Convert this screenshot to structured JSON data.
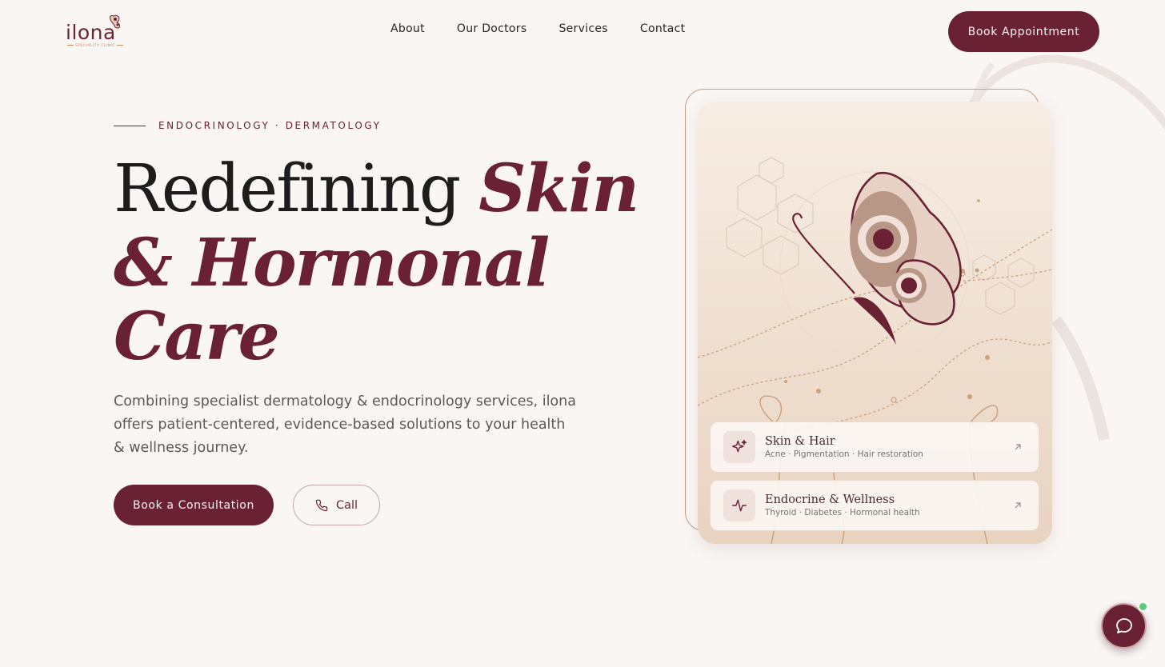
{
  "brand": {
    "name": "ilona",
    "tagline": "SPECIALITY CLINIC",
    "logo_icon": "butterfly-icon"
  },
  "nav": {
    "items": [
      "About",
      "Our Doctors",
      "Services",
      "Contact"
    ]
  },
  "header": {
    "cta_label": "Book Appointment"
  },
  "hero": {
    "eyebrow": "ENDOCRINOLOGY · DERMATOLOGY",
    "title_plain": "Redefining",
    "title_italic_1": "Skin",
    "title_italic_2": "& Hormonal",
    "title_italic_3": "Care",
    "description": "Combining specialist dermatology & endocrinology services, ilona offers patient-centered, evidence-based solutions to your health & wellness journey.",
    "primary_cta": "Book a Consultation",
    "secondary_cta": "Call",
    "secondary_icon": "phone-icon"
  },
  "services": [
    {
      "title": "Skin & Hair",
      "subtitle": "Acne · Pigmentation · Hair restoration",
      "icon": "sparkles-icon"
    },
    {
      "title": "Endocrine & Wellness",
      "subtitle": "Thyroid · Diabetes · Hormonal health",
      "icon": "pulse-icon"
    }
  ],
  "chat": {
    "icon": "chat-bubble-icon",
    "status": "online"
  },
  "colors": {
    "background": "#f9f6f4",
    "brand": "#6b2134",
    "accent": "#c99c7e",
    "online": "#5fc77a"
  }
}
